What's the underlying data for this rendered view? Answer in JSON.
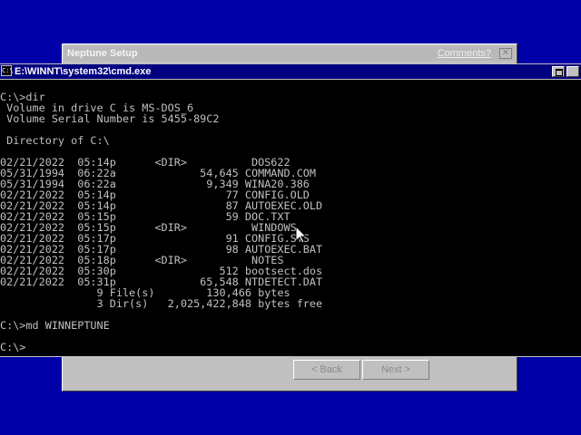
{
  "setup_dialog": {
    "title": "Neptune Setup",
    "comments_link": "Comments?",
    "close_glyph": "✕",
    "back_label": "< Back",
    "next_label": "Next >"
  },
  "cmd_window": {
    "title": "E:\\WINNT\\system32\\cmd.exe",
    "icon_text": "C:\\",
    "console_lines": [
      "C:\\>dir",
      " Volume in drive C is MS-DOS_6",
      " Volume Serial Number is 5455-89C2",
      "",
      " Directory of C:\\",
      "",
      "02/21/2022  05:14p      <DIR>          DOS622",
      "05/31/1994  06:22a             54,645 COMMAND.COM",
      "05/31/1994  06:22a              9,349 WINA20.386",
      "02/21/2022  05:14p                 77 CONFIG.OLD",
      "02/21/2022  05:14p                 87 AUTOEXEC.OLD",
      "02/21/2022  05:15p                 59 DOC.TXT",
      "02/21/2022  05:15p      <DIR>          WINDOWS",
      "02/21/2022  05:17p                 91 CONFIG.SYS",
      "02/21/2022  05:17p                 98 AUTOEXEC.BAT",
      "02/21/2022  05:18p      <DIR>          NOTES",
      "02/21/2022  05:30p                512 bootsect.dos",
      "02/21/2022  05:31p             65,548 NTDETECT.DAT",
      "               9 File(s)        130,466 bytes",
      "               3 Dir(s)   2,025,422,848 bytes free",
      "",
      "C:\\>md WINNEPTUNE",
      "",
      "C:\\>"
    ]
  }
}
